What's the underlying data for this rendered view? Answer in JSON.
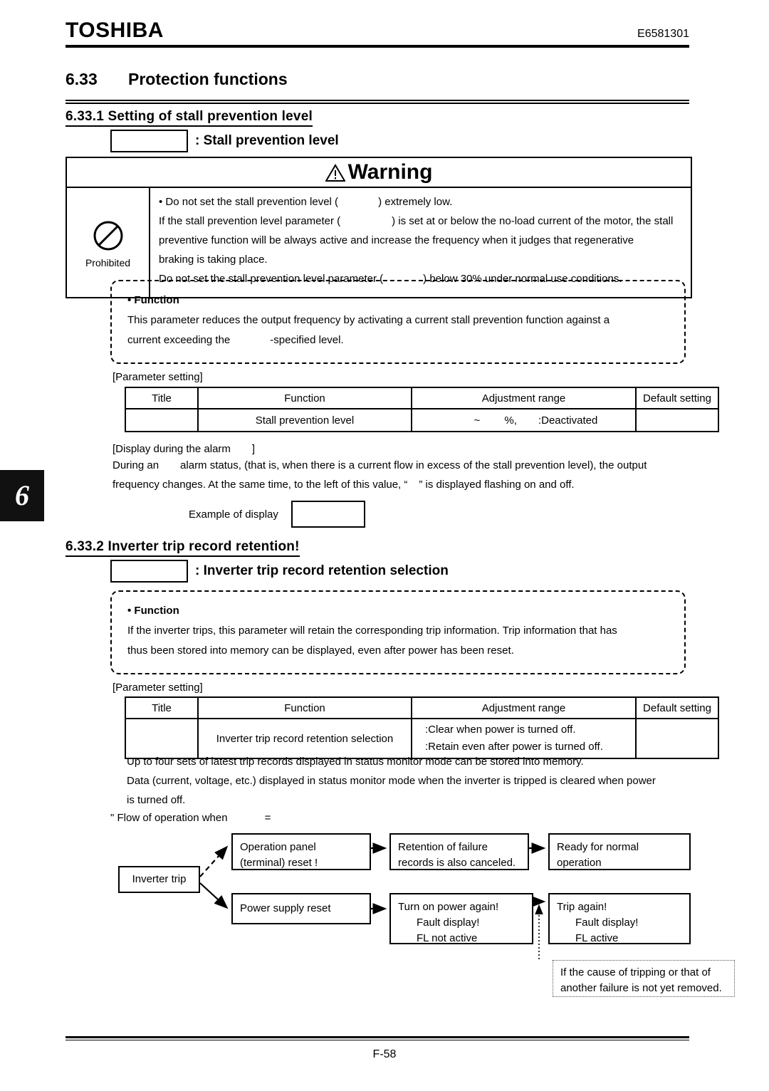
{
  "header": {
    "brand": "TOSHIBA",
    "doc_id": "E6581301"
  },
  "section": {
    "number": "6.33",
    "title": "Protection functions"
  },
  "subsection_1": {
    "heading": "6.33.1  Setting  of  stall  prevention  level",
    "param_box_value": "",
    "param_label": ": Stall prevention level"
  },
  "warning": {
    "title": "Warning",
    "icon_label": "Prohibited",
    "lines": [
      {
        "pre": "• Do not set the stall prevention level (",
        "blank": "",
        "post": ") extremely low."
      },
      {
        "pre": "If the stall prevention level parameter (",
        "blank": "",
        "post": ") is set at or below the no-load current of the motor, the stall"
      },
      {
        "pre": "preventive function will be always active and increase the frequency when it judges that regenerative",
        "blank": "",
        "post": ""
      },
      {
        "pre": "braking is taking place.",
        "blank": "",
        "post": ""
      },
      {
        "pre": "Do not set the stall prevention level parameter (",
        "blank": "",
        "post": ") below 30% under normal use conditions."
      }
    ]
  },
  "function_1": {
    "title": "• Function",
    "line_1": "This parameter reduces the output frequency by activating a current stall prevention function against a",
    "line_2_pre": "current exceeding the",
    "line_2_blank": "",
    "line_2_post": "-specified level."
  },
  "table_1": {
    "caption": "[Parameter setting]",
    "columns": [
      "Title",
      "Function",
      "Adjustment range",
      "Default setting"
    ],
    "rows": [
      {
        "title": "",
        "function": "Stall prevention level",
        "adjustment_min": "",
        "adjustment_tilde": "~",
        "adjustment_max": "",
        "adjustment_unit": "%,",
        "adjustment_off": ":Deactivated",
        "default": ""
      }
    ]
  },
  "alarm_display": {
    "caption_pre": "[Display during the alarm",
    "caption_blank": "",
    "caption_post": "]",
    "para_1_pre": "During an",
    "para_1_blank": "",
    "para_1_post": "alarm status, (that is, when there is a current flow in excess of the stall prevention level), the output",
    "para_2_pre": "frequency changes. At the same time, to the left of this value, “",
    "para_2_blank": "",
    "para_2_post": "” is displayed flashing on and off.",
    "example_label": "Example of display",
    "example_value": ""
  },
  "subsection_2": {
    "heading": "6.33.2  Inverter  trip  record  retention",
    "heading_suffix": "!",
    "param_box_value": "",
    "param_label": ": Inverter trip record retention selection"
  },
  "function_2": {
    "title": "• Function",
    "line_1": "If the inverter trips, this parameter will retain the corresponding trip information. Trip information that has",
    "line_2": "thus been stored into memory can be displayed, even after power has been reset."
  },
  "table_2": {
    "caption": "[Parameter setting]",
    "columns": [
      "Title",
      "Function",
      "Adjustment range",
      "Default setting"
    ],
    "rows": [
      {
        "title": "",
        "function": "Inverter trip record retention selection",
        "adjustment_line_1": ":Clear when power is turned off.",
        "adjustment_line_2": ":Retain even after power is turned off.",
        "default": ""
      }
    ]
  },
  "notes_after_table_2": {
    "line_1": "Up to four sets of latest trip records displayed in status monitor mode can be stored into memory.",
    "line_2": "Data (current, voltage, etc.) displayed in status monitor mode when the inverter is tripped is cleared when power",
    "line_3": "is turned off."
  },
  "flow": {
    "caption_pre": "\"  Flow of operation when",
    "caption_blank": "",
    "caption_eq": "=",
    "caption_post": "",
    "boxes": {
      "inverter_trip": "Inverter trip",
      "operation_panel_line_1": "Operation panel",
      "operation_panel_line_2": "(terminal) reset  !",
      "retention_line_1": "Retention of failure",
      "retention_line_2": "records is also canceled.",
      "ready_line_1": "Ready for normal",
      "ready_line_2": "operation",
      "power_supply_reset": "Power supply reset",
      "turn_on_line_1": "Turn on power again!",
      "turn_on_line_2": "Fault display!",
      "turn_on_line_3": "FL not active",
      "trip_again_line_1": "Trip again!",
      "trip_again_line_2": "Fault display!",
      "trip_again_line_3": "FL active",
      "note_line_1": "If the cause of tripping or that of",
      "note_line_2": "another failure is not yet removed."
    }
  },
  "chapter_tab": {
    "number": "6"
  },
  "footer": {
    "page": "F-58"
  }
}
